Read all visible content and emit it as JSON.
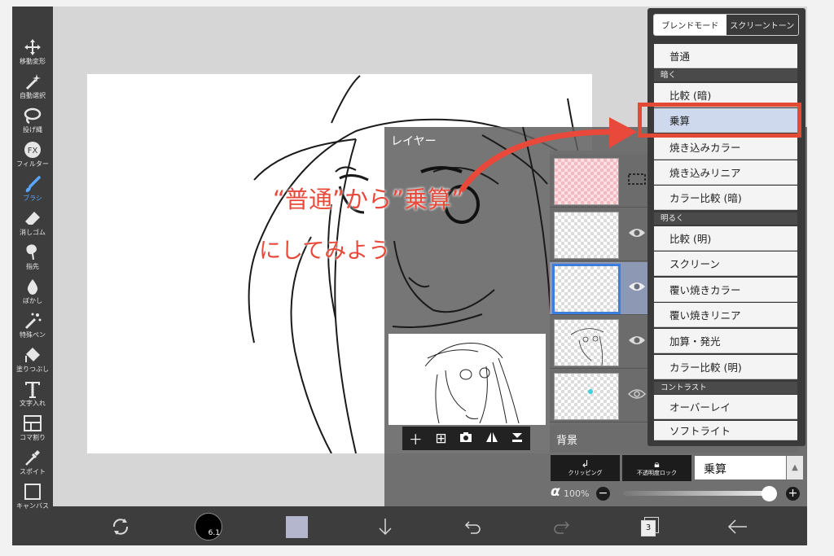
{
  "toolbar": {
    "tools": [
      {
        "id": "move",
        "label": "移動変形",
        "icon": "move-arrows-icon"
      },
      {
        "id": "magic",
        "label": "自動選択",
        "icon": "magic-wand-icon"
      },
      {
        "id": "lasso",
        "label": "投げ縄",
        "icon": "lasso-icon"
      },
      {
        "id": "filter",
        "label": "フィルター",
        "icon": "fx-icon"
      },
      {
        "id": "brush",
        "label": "ブラシ",
        "icon": "brush-icon",
        "active": true
      },
      {
        "id": "eraser",
        "label": "消しゴム",
        "icon": "eraser-icon"
      },
      {
        "id": "finger",
        "label": "指先",
        "icon": "finger-icon"
      },
      {
        "id": "blur",
        "label": "ぼかし",
        "icon": "drop-icon"
      },
      {
        "id": "special",
        "label": "特殊ペン",
        "icon": "sparkle-pen-icon"
      },
      {
        "id": "fill",
        "label": "塗りつぶし",
        "icon": "bucket-icon"
      },
      {
        "id": "text",
        "label": "文字入れ",
        "icon": "text-icon"
      },
      {
        "id": "frame",
        "label": "コマ割り",
        "icon": "frame-icon"
      },
      {
        "id": "dropper",
        "label": "スポイト",
        "icon": "eyedropper-icon"
      },
      {
        "id": "canvas",
        "label": "キャンバス",
        "icon": "canvas-icon"
      }
    ]
  },
  "layer_panel": {
    "title": "レイヤー",
    "background_label": "背景",
    "clipping_label": "クリッピング",
    "lock_label": "不透明度ロック",
    "blend_value": "乗算",
    "alpha_symbol": "α",
    "alpha_value": "100%",
    "alpha_level": 0.95
  },
  "blend_popup": {
    "tab_blend": "ブレンドモード",
    "tab_screentone": "スクリーントーン",
    "items": [
      {
        "type": "item",
        "label": "普通"
      },
      {
        "type": "head",
        "label": "暗く"
      },
      {
        "type": "item",
        "label": "比較 (暗)"
      },
      {
        "type": "item",
        "label": "乗算",
        "active": true
      },
      {
        "type": "item",
        "label": "焼き込みカラー"
      },
      {
        "type": "item",
        "label": "焼き込みリニア"
      },
      {
        "type": "item",
        "label": "カラー比較 (暗)"
      },
      {
        "type": "head",
        "label": "明るく"
      },
      {
        "type": "item",
        "label": "比較 (明)"
      },
      {
        "type": "item",
        "label": "スクリーン"
      },
      {
        "type": "item",
        "label": "覆い焼きカラー"
      },
      {
        "type": "item",
        "label": "覆い焼きリニア"
      },
      {
        "type": "item",
        "label": "加算・発光"
      },
      {
        "type": "item",
        "label": "カラー比較 (明)"
      },
      {
        "type": "head",
        "label": "コントラスト"
      },
      {
        "type": "item",
        "label": "オーバーレイ"
      },
      {
        "type": "item",
        "label": "ソフトライト"
      }
    ]
  },
  "annotation": {
    "line1": "“普通”から”乗算”",
    "line2": "にしてみよう",
    "color": "#e8493a"
  },
  "bottom_bar": {
    "brush_size": "6.1",
    "layer_count": "3",
    "color_swatch": "#b3b6cc"
  }
}
